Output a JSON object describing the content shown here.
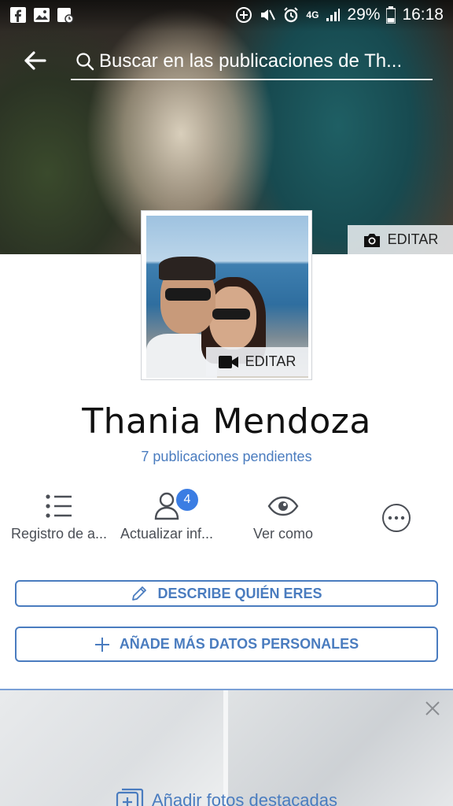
{
  "status_bar": {
    "battery": "29%",
    "time": "16:18",
    "network": "4G"
  },
  "search": {
    "placeholder": "Buscar en las publicaciones de Th..."
  },
  "cover": {
    "edit_label": "EDITAR"
  },
  "profile": {
    "edit_label": "EDITAR",
    "name": "Thania Mendoza",
    "pending": "7 publicaciones pendientes"
  },
  "actions": [
    {
      "label": "Registro de a...",
      "icon": "list-icon"
    },
    {
      "label": "Actualizar inf...",
      "icon": "person-icon",
      "badge": "4"
    },
    {
      "label": "Ver como",
      "icon": "eye-icon"
    },
    {
      "label": "",
      "icon": "more-icon"
    }
  ],
  "buttons": {
    "describe": "DESCRIBE QUIÉN ERES",
    "add_details": "AÑADE MÁS DATOS PERSONALES"
  },
  "featured": {
    "add_label": "Añadir fotos destacadas"
  },
  "colors": {
    "accent": "#4a7cbf",
    "badge": "#3b7de3"
  }
}
